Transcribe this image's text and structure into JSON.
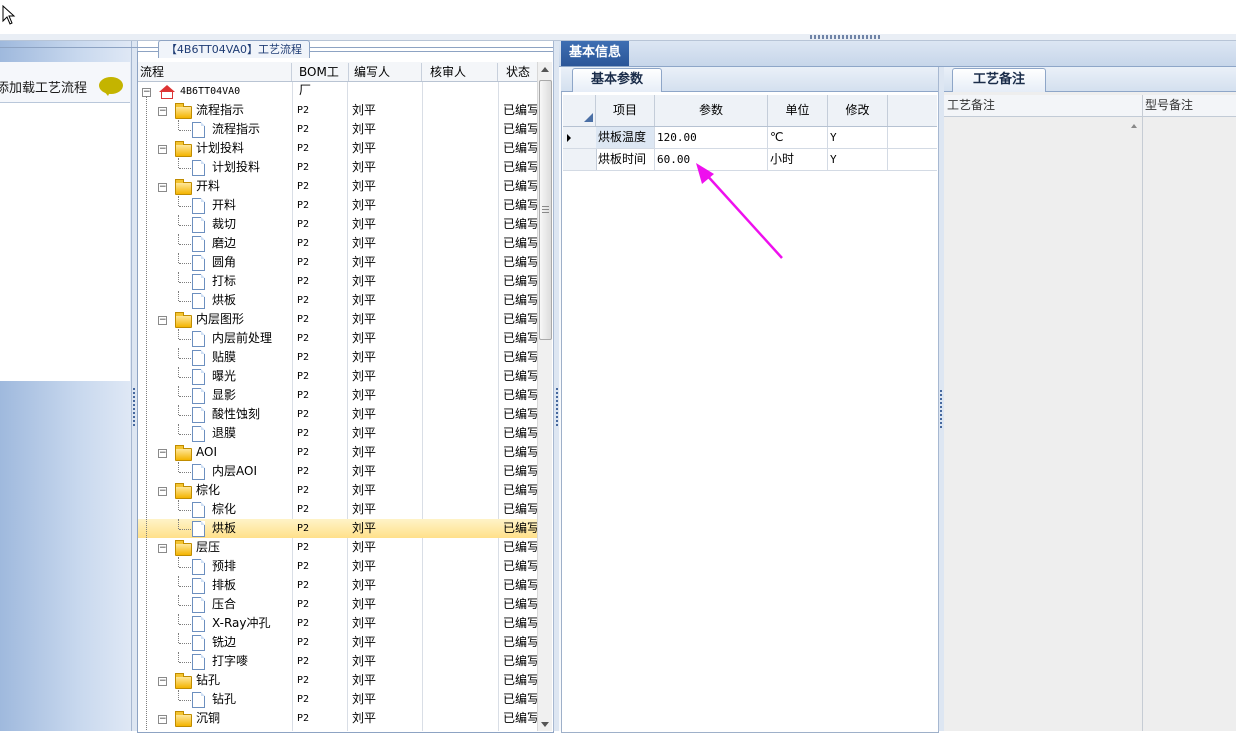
{
  "left_panel": {
    "label": "添加载工艺流程"
  },
  "tree_panel": {
    "title": "【4B6TT04VA0】工艺流程",
    "columns": [
      "流程",
      "BOM工厂",
      "编写人",
      "核审人",
      "状态"
    ],
    "rows": [
      {
        "name": "4B6TT04VA0",
        "bom": "",
        "writer": "",
        "reviewer": "",
        "status": "",
        "level": 0,
        "type": "root"
      },
      {
        "name": "流程指示",
        "bom": "P2",
        "writer": "刘平",
        "reviewer": "",
        "status": "已编写",
        "level": 1,
        "type": "folder"
      },
      {
        "name": "流程指示",
        "bom": "P2",
        "writer": "刘平",
        "reviewer": "",
        "status": "已编写",
        "level": 2,
        "type": "doc"
      },
      {
        "name": "计划投料",
        "bom": "P2",
        "writer": "刘平",
        "reviewer": "",
        "status": "已编写",
        "level": 1,
        "type": "folder"
      },
      {
        "name": "计划投料",
        "bom": "P2",
        "writer": "刘平",
        "reviewer": "",
        "status": "已编写",
        "level": 2,
        "type": "doc"
      },
      {
        "name": "开料",
        "bom": "P2",
        "writer": "刘平",
        "reviewer": "",
        "status": "已编写",
        "level": 1,
        "type": "folder"
      },
      {
        "name": "开料",
        "bom": "P2",
        "writer": "刘平",
        "reviewer": "",
        "status": "已编写",
        "level": 2,
        "type": "doc"
      },
      {
        "name": "裁切",
        "bom": "P2",
        "writer": "刘平",
        "reviewer": "",
        "status": "已编写",
        "level": 2,
        "type": "doc"
      },
      {
        "name": "磨边",
        "bom": "P2",
        "writer": "刘平",
        "reviewer": "",
        "status": "已编写",
        "level": 2,
        "type": "doc"
      },
      {
        "name": "圆角",
        "bom": "P2",
        "writer": "刘平",
        "reviewer": "",
        "status": "已编写",
        "level": 2,
        "type": "doc"
      },
      {
        "name": "打标",
        "bom": "P2",
        "writer": "刘平",
        "reviewer": "",
        "status": "已编写",
        "level": 2,
        "type": "doc"
      },
      {
        "name": "烘板",
        "bom": "P2",
        "writer": "刘平",
        "reviewer": "",
        "status": "已编写",
        "level": 2,
        "type": "doc"
      },
      {
        "name": "内层图形",
        "bom": "P2",
        "writer": "刘平",
        "reviewer": "",
        "status": "已编写",
        "level": 1,
        "type": "folder"
      },
      {
        "name": "内层前处理",
        "bom": "P2",
        "writer": "刘平",
        "reviewer": "",
        "status": "已编写",
        "level": 2,
        "type": "doc"
      },
      {
        "name": "贴膜",
        "bom": "P2",
        "writer": "刘平",
        "reviewer": "",
        "status": "已编写",
        "level": 2,
        "type": "doc"
      },
      {
        "name": "曝光",
        "bom": "P2",
        "writer": "刘平",
        "reviewer": "",
        "status": "已编写",
        "level": 2,
        "type": "doc"
      },
      {
        "name": "显影",
        "bom": "P2",
        "writer": "刘平",
        "reviewer": "",
        "status": "已编写",
        "level": 2,
        "type": "doc"
      },
      {
        "name": "酸性蚀刻",
        "bom": "P2",
        "writer": "刘平",
        "reviewer": "",
        "status": "已编写",
        "level": 2,
        "type": "doc"
      },
      {
        "name": "退膜",
        "bom": "P2",
        "writer": "刘平",
        "reviewer": "",
        "status": "已编写",
        "level": 2,
        "type": "doc"
      },
      {
        "name": "AOI",
        "bom": "P2",
        "writer": "刘平",
        "reviewer": "",
        "status": "已编写",
        "level": 1,
        "type": "folder"
      },
      {
        "name": "内层AOI",
        "bom": "P2",
        "writer": "刘平",
        "reviewer": "",
        "status": "已编写",
        "level": 2,
        "type": "doc"
      },
      {
        "name": "棕化",
        "bom": "P2",
        "writer": "刘平",
        "reviewer": "",
        "status": "已编写",
        "level": 1,
        "type": "folder"
      },
      {
        "name": "棕化",
        "bom": "P2",
        "writer": "刘平",
        "reviewer": "",
        "status": "已编写",
        "level": 2,
        "type": "doc"
      },
      {
        "name": "烘板",
        "bom": "P2",
        "writer": "刘平",
        "reviewer": "",
        "status": "已编写",
        "level": 2,
        "type": "doc",
        "selected": true
      },
      {
        "name": "层压",
        "bom": "P2",
        "writer": "刘平",
        "reviewer": "",
        "status": "已编写",
        "level": 1,
        "type": "folder"
      },
      {
        "name": "预排",
        "bom": "P2",
        "writer": "刘平",
        "reviewer": "",
        "status": "已编写",
        "level": 2,
        "type": "doc"
      },
      {
        "name": "排板",
        "bom": "P2",
        "writer": "刘平",
        "reviewer": "",
        "status": "已编写",
        "level": 2,
        "type": "doc"
      },
      {
        "name": "压合",
        "bom": "P2",
        "writer": "刘平",
        "reviewer": "",
        "status": "已编写",
        "level": 2,
        "type": "doc"
      },
      {
        "name": "X-Ray冲孔",
        "bom": "P2",
        "writer": "刘平",
        "reviewer": "",
        "status": "已编写",
        "level": 2,
        "type": "doc"
      },
      {
        "name": "铣边",
        "bom": "P2",
        "writer": "刘平",
        "reviewer": "",
        "status": "已编写",
        "level": 2,
        "type": "doc"
      },
      {
        "name": "打字嘜",
        "bom": "P2",
        "writer": "刘平",
        "reviewer": "",
        "status": "已编写",
        "level": 2,
        "type": "doc"
      },
      {
        "name": "钻孔",
        "bom": "P2",
        "writer": "刘平",
        "reviewer": "",
        "status": "已编写",
        "level": 1,
        "type": "folder"
      },
      {
        "name": "钻孔",
        "bom": "P2",
        "writer": "刘平",
        "reviewer": "",
        "status": "已编写",
        "level": 2,
        "type": "doc"
      },
      {
        "name": "沉铜",
        "bom": "P2",
        "writer": "刘平",
        "reviewer": "",
        "status": "已编写",
        "level": 1,
        "type": "folder"
      }
    ]
  },
  "info_panel": {
    "tab": "基本信息",
    "subtab": "基本参数",
    "columns": [
      "项目",
      "参数",
      "单位",
      "修改"
    ],
    "rows": [
      {
        "item": "烘板温度",
        "param": "120.00",
        "unit": "℃",
        "modified": "Y"
      },
      {
        "item": "烘板时间",
        "param": "60.00",
        "unit": "小时",
        "modified": "Y"
      }
    ]
  },
  "notes_panel": {
    "tab": "工艺备注",
    "columns": [
      "工艺备注",
      "型号备注"
    ]
  },
  "annotation": {
    "arrow_color": "#ee10ee"
  },
  "colors": {
    "selection": "#ffe08a",
    "tab_active": "#2b5698"
  }
}
